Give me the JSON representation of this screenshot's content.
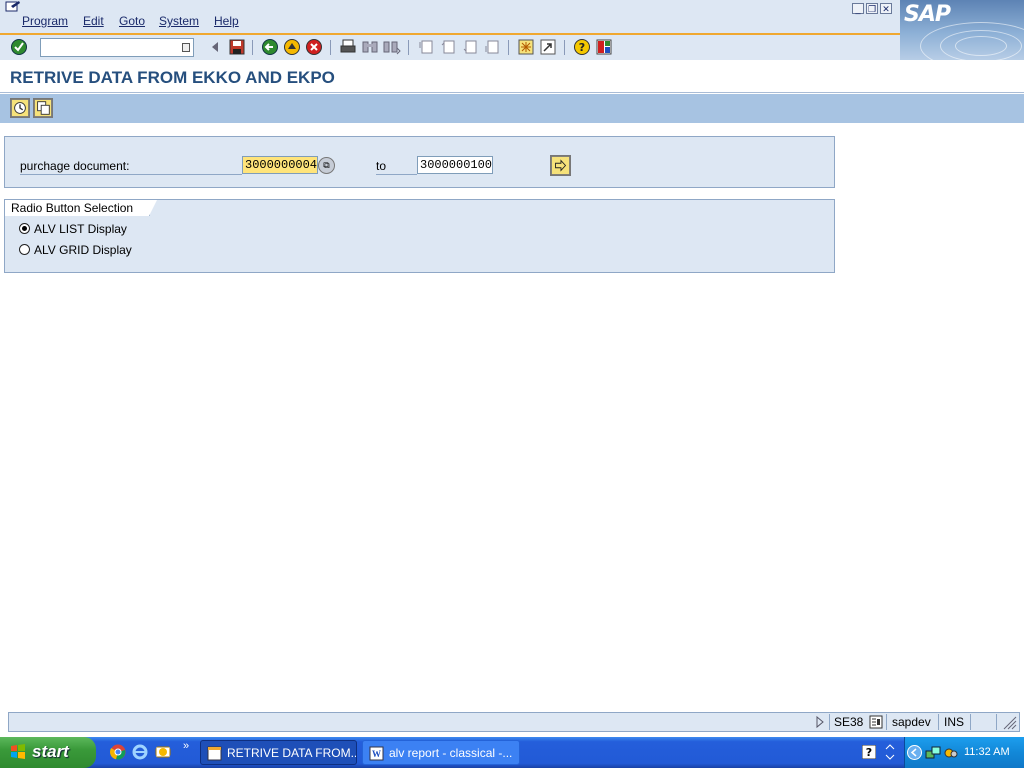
{
  "menubar": {
    "items": [
      "Program",
      "Edit",
      "Goto",
      "System",
      "Help"
    ]
  },
  "logo": {
    "text": "SAP"
  },
  "toolbar": {
    "icons": [
      "enter-icon",
      "back-small-icon",
      "save-icon",
      "back-icon",
      "exit-icon",
      "cancel-icon",
      "print-icon",
      "find-icon",
      "find-next-icon",
      "first-page-icon",
      "prev-page-icon",
      "next-page-icon",
      "last-page-icon",
      "new-session-icon",
      "shortcut-icon",
      "help-icon",
      "layout-icon"
    ]
  },
  "title": "RETRIVE DATA FROM EKKO AND EKPO",
  "selection": {
    "label": "purchage document:",
    "low": "3000000004",
    "to_label": "to",
    "high": "3000000100"
  },
  "radio_frame": {
    "title": "Radio Button Selection",
    "options": [
      {
        "label": "ALV LIST Display",
        "selected": true
      },
      {
        "label": "ALV GRID Display",
        "selected": false
      }
    ]
  },
  "statusbar": {
    "transaction": "SE38",
    "server": "sapdev",
    "mode": "INS"
  },
  "taskbar": {
    "start": "start",
    "tasks": [
      "RETRIVE DATA FROM...",
      "alv report - classical -..."
    ],
    "more": "»",
    "clock": "11:32 AM"
  },
  "colors": {
    "accent": "#264f7e",
    "toolbar_bg": "#dde7f3",
    "app_toolbar_bg": "#a7c3e2",
    "input_highlight": "#ffe47a"
  }
}
